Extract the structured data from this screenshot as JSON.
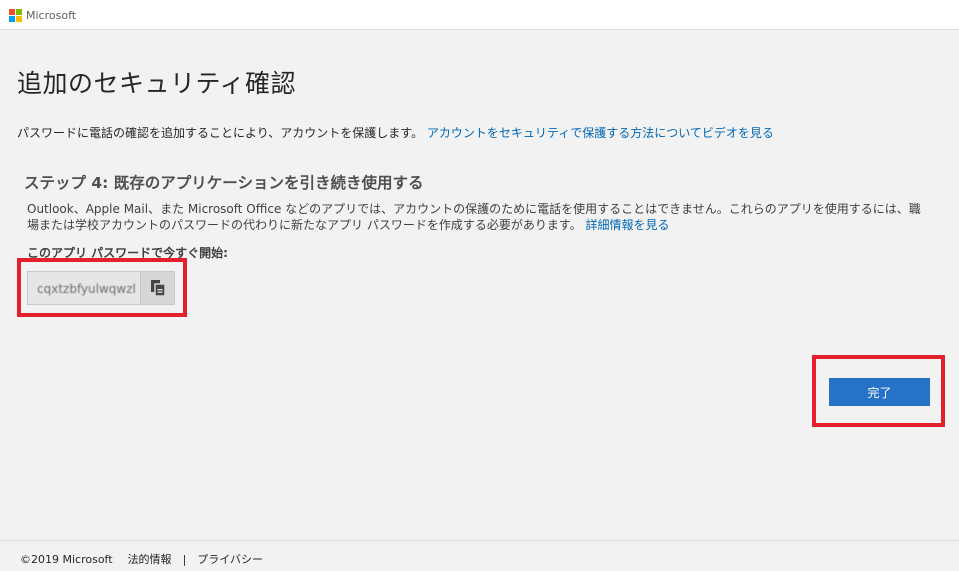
{
  "header": {
    "logo_text": "Microsoft",
    "logo_colors": [
      "#f25022",
      "#7fba00",
      "#00a4ef",
      "#ffb900"
    ]
  },
  "main": {
    "title": "追加のセキュリティ確認",
    "intro_text": "パスワードに電話の確認を追加することにより、アカウントを保護します。",
    "intro_link": "アカウントをセキュリティで保護する方法についてビデオを見る",
    "step_title": "ステップ 4: 既存のアプリケーションを引き続き使用する",
    "description": "Outlook、Apple Mail、また Microsoft Office などのアプリでは、アカウントの保護のために電話を使用することはできません。これらのアプリを使用するには、職場または学校アカウントのパスワードの代わりに新たなアプリ パスワードを作成する必要があります。",
    "description_link": "詳細情報を見る",
    "start_label": "このアプリ パスワードで今すぐ開始:",
    "app_password": "cqxtzbfyulwqwzl",
    "copy_icon": "copy-icon",
    "done_button": "完了"
  },
  "footer": {
    "copyright": "©2019 Microsoft",
    "legal_link": "法的情報",
    "separator": "|",
    "privacy_link": "プライバシー"
  },
  "colors": {
    "accent": "#2672c7",
    "link": "#0067b8",
    "highlight_border": "#e3202b"
  }
}
